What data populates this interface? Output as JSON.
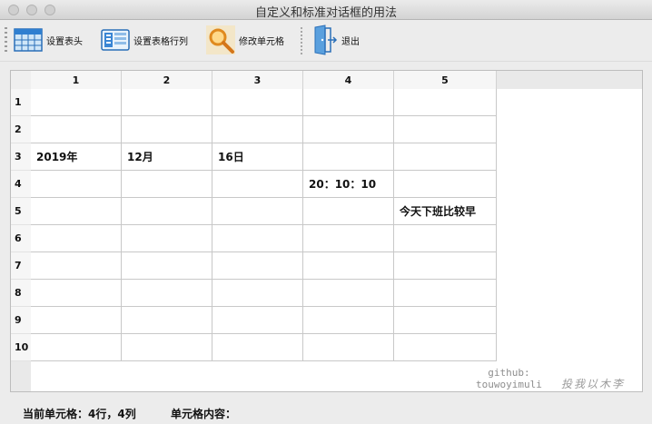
{
  "window": {
    "title": "自定义和标准对话框的用法"
  },
  "toolbar": {
    "buttons": [
      {
        "label": "设置表头",
        "icon": "table-header-icon"
      },
      {
        "label": "设置表格行列",
        "icon": "table-rows-columns-icon"
      },
      {
        "label": "修改单元格",
        "icon": "magnifier-icon"
      },
      {
        "label": "退出",
        "icon": "exit-door-icon"
      }
    ]
  },
  "table": {
    "columns": [
      "1",
      "2",
      "3",
      "4",
      "5"
    ],
    "rows": [
      "1",
      "2",
      "3",
      "4",
      "5",
      "6",
      "7",
      "8",
      "9",
      "10"
    ],
    "cells": [
      [
        "",
        "",
        "",
        "",
        ""
      ],
      [
        "",
        "",
        "",
        "",
        ""
      ],
      [
        "2019年",
        "12月",
        "16日",
        "",
        ""
      ],
      [
        "",
        "",
        "",
        "20：10：10",
        ""
      ],
      [
        "",
        "",
        "",
        "",
        "今天下班比较早"
      ],
      [
        "",
        "",
        "",
        "",
        ""
      ],
      [
        "",
        "",
        "",
        "",
        ""
      ],
      [
        "",
        "",
        "",
        "",
        ""
      ],
      [
        "",
        "",
        "",
        "",
        ""
      ],
      [
        "",
        "",
        "",
        "",
        ""
      ]
    ]
  },
  "watermark": {
    "line1": "github:",
    "line2": "touwoyimuli",
    "line3": "投我以木李"
  },
  "status": {
    "current_cell": "当前单元格：4行，4列",
    "cell_content": "单元格内容："
  }
}
